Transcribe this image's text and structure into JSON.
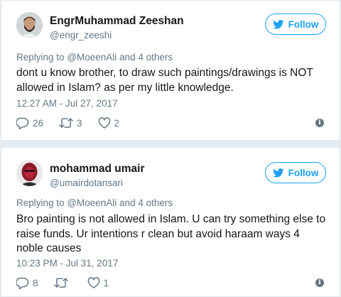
{
  "tweets": [
    {
      "name": "EngrMuhammad Zeeshan",
      "handle": "@engr_zeeshi",
      "follow_label": "Follow",
      "reply_prefix": "Replying to",
      "reply_users": "@MoeenAli and 4 others",
      "text": "dont u know brother, to draw such paintings/drawings is NOT allowed in Islam? as per my little knowledge.",
      "time": "12:27 AM - Jul 27, 2017",
      "replies": "26",
      "retweets": "3",
      "likes": "2"
    },
    {
      "name": "mohammad umair",
      "handle": "@umairdotansari",
      "follow_label": "Follow",
      "reply_prefix": "Replying to",
      "reply_users": "@MoeenAli and 4 others",
      "text": "Bro painting is not allowed in Islam. U can try something else to raise funds. Ur intentions r clean but avoid haraam ways 4 noble causes",
      "time": "10:23 PM - Jul 31, 2017",
      "replies": "8",
      "retweets": "",
      "likes": "1"
    }
  ],
  "colors": {
    "accent": "#1da1f2",
    "muted": "#657786",
    "text": "#14171a",
    "background": "#e6ecf0"
  },
  "icons": [
    "twitter-bird-icon",
    "reply-icon",
    "retweet-icon",
    "like-icon",
    "info-icon"
  ]
}
